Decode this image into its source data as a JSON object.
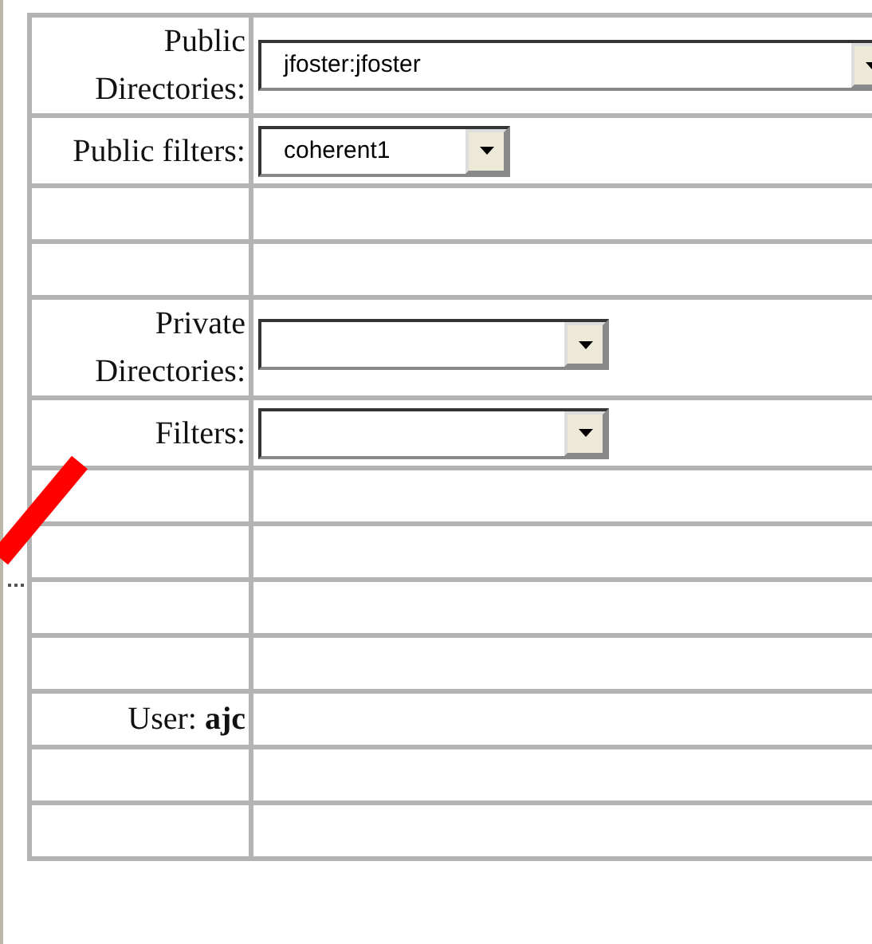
{
  "rows": [
    {
      "kind": "wide_select",
      "label": "Public Directories:",
      "value": "jfoster:jfoster"
    },
    {
      "kind": "select",
      "label": "Public filters:",
      "value": "coherent1"
    },
    {
      "kind": "empty"
    },
    {
      "kind": "empty"
    },
    {
      "kind": "select",
      "label": "Private Directories:"
    },
    {
      "kind": "select",
      "label": "Filters:"
    },
    {
      "kind": "empty"
    },
    {
      "kind": "empty"
    },
    {
      "kind": "empty"
    },
    {
      "kind": "empty"
    },
    {
      "kind": "text",
      "label": "User: **ajc**"
    },
    {
      "kind": "empty"
    },
    {
      "kind": "empty"
    }
  ]
}
